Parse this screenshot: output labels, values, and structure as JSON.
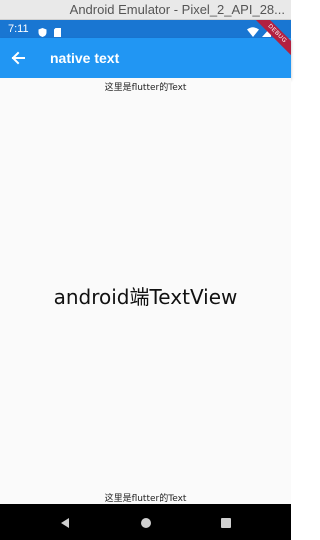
{
  "window": {
    "title": "Android Emulator - Pixel_2_API_28..."
  },
  "status_bar": {
    "time": "7:11"
  },
  "app_bar": {
    "title": "native text",
    "debug_banner": "DEBUG"
  },
  "content": {
    "flutter_text_top": "这里是flutter的Text",
    "native_text": "android端TextView",
    "flutter_text_bottom": "这里是flutter的Text"
  },
  "colors": {
    "app_bar": "#2196f3",
    "status_bar": "#1976d2",
    "background": "#fafafa"
  },
  "icons": [
    "back-arrow-icon",
    "shield-icon",
    "sd-card-icon",
    "wifi-icon",
    "signal-icon",
    "battery-icon",
    "nav-back-icon",
    "nav-home-icon",
    "nav-recents-icon"
  ]
}
